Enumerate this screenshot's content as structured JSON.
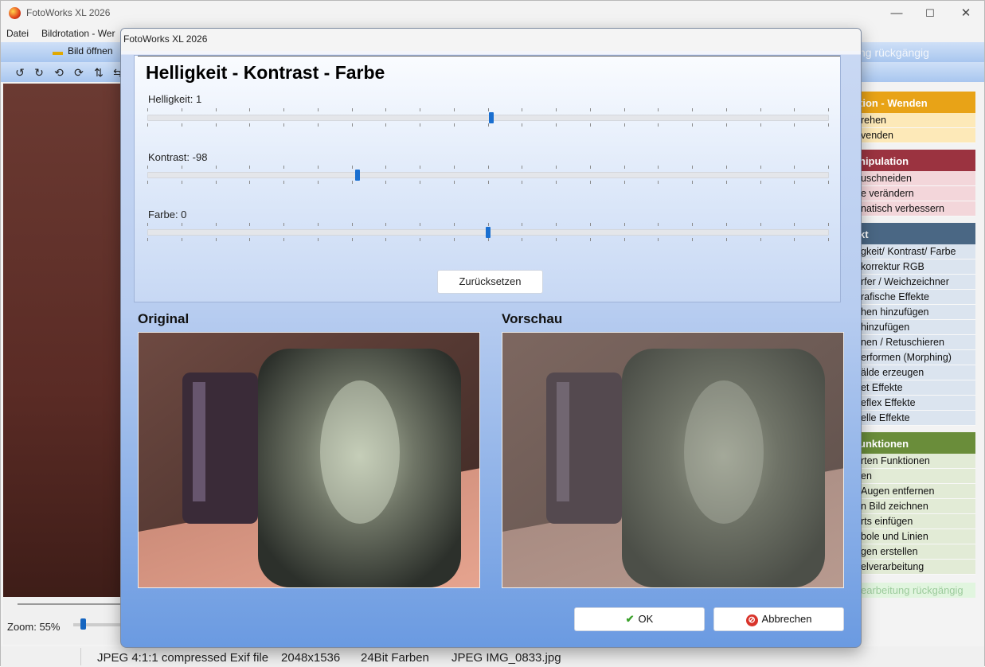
{
  "app": {
    "title": "FotoWorks XL 2026",
    "window_controls": {
      "minimize": "—",
      "maximize": "☐",
      "close": "✕"
    }
  },
  "menu": {
    "items": [
      "Datei",
      "Bildrotation - Wer"
    ]
  },
  "toolbar": {
    "open_label": "Bild öffnen",
    "undo_label": "ng rückgängig"
  },
  "sidebar": {
    "sections": [
      {
        "title": "tion - Wenden",
        "color": "#e8a317",
        "item_bg": "#fde9b8",
        "items": [
          "rehen",
          "venden"
        ]
      },
      {
        "title": "nipulation",
        "color": "#9b3340",
        "item_bg": "#f3d6da",
        "items": [
          "uschneiden",
          "e verändern",
          "natisch verbessern"
        ]
      },
      {
        "title": "kt",
        "color": "#4a6784",
        "item_bg": "#dbe4ef",
        "items": [
          "gkeit/ Kontrast/ Farbe",
          "korrektur RGB",
          "rfer / Weichzeichner",
          "rafische Effekte",
          "hen hinzufügen",
          "hinzufügen",
          "nen / Retuschieren",
          "erformen (Morphing)",
          "älde erzeugen",
          "et Effekte",
          "eflex Effekte",
          "elle Effekte"
        ]
      },
      {
        "title": "unktionen",
        "color": "#6a8d3a",
        "item_bg": "#e2ebd6",
        "items": [
          "rten Funktionen",
          "en",
          "Augen entfernen",
          "n Bild zeichnen",
          "rts einfügen",
          "bole und Linien",
          "gen erstellen",
          "elverarbeitung"
        ]
      }
    ],
    "faded_item": "earbeitung rückgängig"
  },
  "zoom": {
    "label": "Zoom: 55%",
    "level_percent": 55
  },
  "status": {
    "format": "JPEG 4:1:1 compressed Exif file",
    "dimensions": "2048x1536",
    "colors": "24Bit Farben",
    "file": "JPEG IMG_0833.jpg"
  },
  "dialog": {
    "title": "FotoWorks XL 2026",
    "heading": "Helligkeit - Kontrast - Farbe",
    "sliders": [
      {
        "name": "brightness",
        "label": "Helligkeit: 1",
        "value": 1,
        "min": -100,
        "max": 100
      },
      {
        "name": "contrast",
        "label": "Kontrast: -98",
        "value": -98,
        "min": -255,
        "max": 255
      },
      {
        "name": "color",
        "label": "Farbe: 0",
        "value": 0,
        "min": -100,
        "max": 100
      }
    ],
    "reset_label": "Zurücksetzen",
    "original_label": "Original",
    "preview_label": "Vorschau",
    "ok_label": "OK",
    "cancel_label": "Abbrechen",
    "ok_icon": "checkmark-icon",
    "cancel_icon": "cancel-icon",
    "accent": "#1a6fd0"
  }
}
